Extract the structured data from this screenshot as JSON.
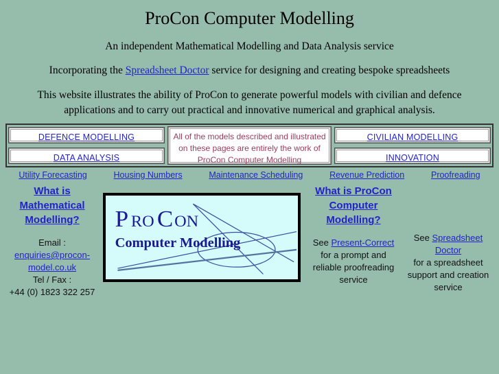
{
  "header": {
    "title": "ProCon Computer Modelling",
    "tagline": "An independent Mathematical Modelling and Data Analysis service",
    "incorporating_pre": "Incorporating the ",
    "incorporating_link": "Spreadsheet Doctor",
    "incorporating_post": " service for designing and creating bespoke spreadsheets",
    "blurb": "This website illustrates the ability of ProCon to generate powerful models with civilian and defence applications and to carry out practical and innovative numerical and graphical analysis."
  },
  "nav": {
    "buttons": [
      {
        "label": "DEFENCE MODELLING",
        "position": "top-left"
      },
      {
        "label": "DATA ANALYSIS",
        "position": "bottom-left"
      },
      {
        "label": "CIVILIAN MODELLING",
        "position": "top-right"
      },
      {
        "label": "INNOVATION",
        "position": "bottom-right"
      }
    ],
    "notice": {
      "line1": "All of the models described and illustrated",
      "line2": "on these pages are entirely the work of",
      "line3": "ProCon Computer Modelling",
      "color": "#9c3b5e"
    },
    "sublinks": [
      {
        "label": "Utility Forecasting"
      },
      {
        "label": "Housing Numbers"
      },
      {
        "label": "Maintenance Scheduling"
      },
      {
        "label": "Revenue Prediction"
      },
      {
        "label": "Proofreading"
      }
    ]
  },
  "columns": {
    "left": {
      "heading_line1": "What is",
      "heading_line2": "Mathematical",
      "heading_line3": "Modelling?",
      "email_label": "Email :",
      "email_line1": "enquiries@procon-",
      "email_line2": "model.co.uk",
      "tel_label": "Tel / Fax :",
      "tel_value": "+44 (0) 1823 322 257"
    },
    "middle": {
      "heading_line1": "What is ProCon",
      "heading_line2": "Computer",
      "heading_line3": "Modelling?",
      "see_pre": "See ",
      "see_link": "Present-Correct",
      "body_line1": "for a prompt and",
      "body_line2": "reliable proofreading",
      "body_line3": "service"
    },
    "right": {
      "see_pre": "See ",
      "see_link_line1": "Spreadsheet",
      "see_link_line2": "Doctor",
      "body_line1": "for a spreadsheet",
      "body_line2": "support and creation",
      "body_line3": "service"
    }
  },
  "logo": {
    "word_pro_p": "P",
    "word_pro_ro": "RO",
    "word_con_c": "C",
    "word_con_on": "ON",
    "subtitle": "Computer Modelling",
    "background": "#d5fbfb",
    "ink": "#1a1a99"
  },
  "theme": {
    "page_background": "#96bcab",
    "link_color": "#2222cc",
    "notice_color": "#9c3b5e"
  }
}
